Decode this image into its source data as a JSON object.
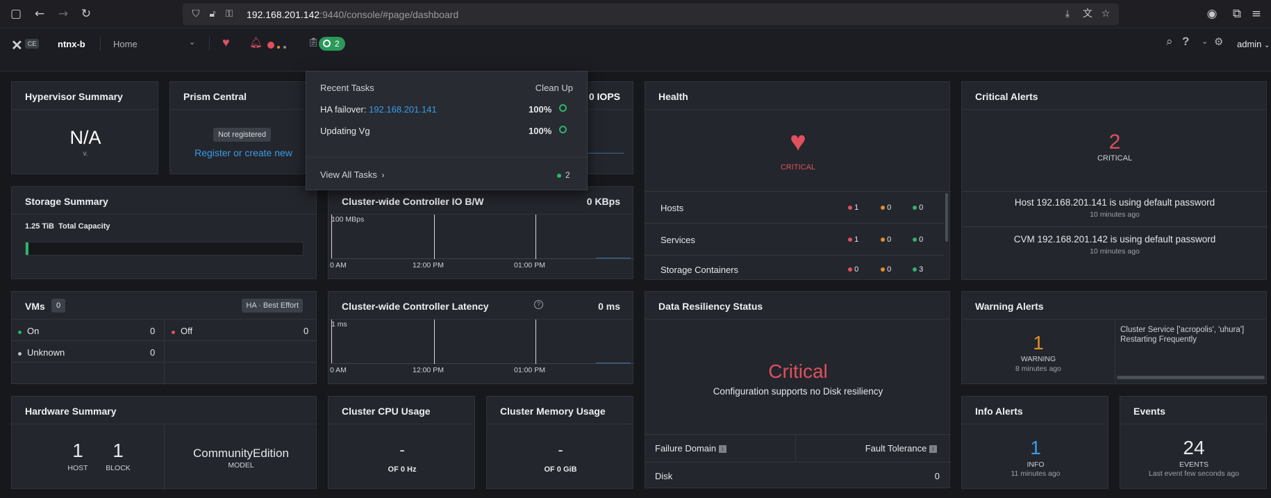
{
  "browser": {
    "url_host": "192.168.201.142",
    "url_rest": ":9440/console/#page/dashboard"
  },
  "header": {
    "logo_badge": "CE",
    "cluster_name": "ntnx-b",
    "nav_selected": "Home",
    "tasks_count": "2",
    "user": "admin"
  },
  "tasks_dropdown": {
    "title": "Recent Tasks",
    "cleanup": "Clean Up",
    "tasks": [
      {
        "label": "HA failover: ",
        "link": "192.168.201.141",
        "pct": "100%"
      },
      {
        "label": "Updating Vg",
        "link": "",
        "pct": "100%"
      }
    ],
    "view_all": "View All Tasks",
    "view_all_count": "2"
  },
  "hypervisor": {
    "title": "Hypervisor Summary",
    "value": "N/A",
    "sub": "v."
  },
  "prism_central": {
    "title": "Prism Central",
    "badge": "Not registered",
    "link": "Register or create new"
  },
  "iops": {
    "value": "0 IOPS"
  },
  "health": {
    "title": "Health",
    "status": "CRITICAL",
    "rows": [
      {
        "name": "Hosts",
        "red": "1",
        "orange": "0",
        "green": "0"
      },
      {
        "name": "Services",
        "red": "1",
        "orange": "0",
        "green": "0"
      },
      {
        "name": "Storage Containers",
        "red": "0",
        "orange": "0",
        "green": "3"
      }
    ]
  },
  "critical_alerts": {
    "title": "Critical Alerts",
    "count": "2",
    "label": "CRITICAL",
    "alerts": [
      {
        "text": "Host 192.168.201.141 is using default password",
        "time": "10 minutes ago"
      },
      {
        "text": "CVM 192.168.201.142 is using default password",
        "time": "10 minutes ago"
      }
    ]
  },
  "storage": {
    "title": "Storage Summary",
    "capacity_value": "1.25 TiB",
    "capacity_label": "Total Capacity",
    "used_fraction": 0.01
  },
  "io_bw": {
    "title": "Cluster-wide Controller IO B/W",
    "value": "0 KBps",
    "ylabel": "100 MBps",
    "ticks": [
      "0 AM",
      "12:00 PM",
      "01:00 PM"
    ]
  },
  "vms": {
    "title": "VMs",
    "count": "0",
    "ha": "HA · Best Effort",
    "on_label": "On",
    "on_value": "0",
    "off_label": "Off",
    "off_value": "0",
    "unknown_label": "Unknown",
    "unknown_value": "0"
  },
  "latency": {
    "title": "Cluster-wide Controller Latency",
    "help": "?",
    "value": "0 ms",
    "ylabel": "1 ms",
    "ticks": [
      "0 AM",
      "12:00 PM",
      "01:00 PM"
    ]
  },
  "resiliency": {
    "title": "Data Resiliency Status",
    "status": "Critical",
    "desc": "Configuration supports no Disk resiliency",
    "col1": "Failure Domain",
    "col2": "Fault Tolerance",
    "row_label": "Disk",
    "row_value": "0"
  },
  "warning_alerts": {
    "title": "Warning Alerts",
    "count": "1",
    "label": "WARNING",
    "time": "8 minutes ago",
    "message": "Cluster Service ['acropolis', 'uhura'] Restarting Frequently"
  },
  "hardware": {
    "title": "Hardware Summary",
    "hosts": "1",
    "hosts_label": "HOST",
    "blocks": "1",
    "blocks_label": "BLOCK",
    "model": "CommunityEdition",
    "model_label": "MODEL"
  },
  "cpu": {
    "title": "Cluster CPU Usage",
    "value": "-",
    "sub": "OF 0 Hz"
  },
  "memory": {
    "title": "Cluster Memory Usage",
    "value": "-",
    "sub": "OF 0 GiB"
  },
  "info_alerts": {
    "title": "Info Alerts",
    "count": "1",
    "label": "INFO",
    "time": "11 minutes ago"
  },
  "events": {
    "title": "Events",
    "count": "24",
    "label": "EVENTS",
    "time": "Last event few seconds ago"
  },
  "colors": {
    "critical": "#e0505e",
    "warning": "#e38d2b",
    "ok": "#2fb36b",
    "link": "#3b9be8"
  }
}
